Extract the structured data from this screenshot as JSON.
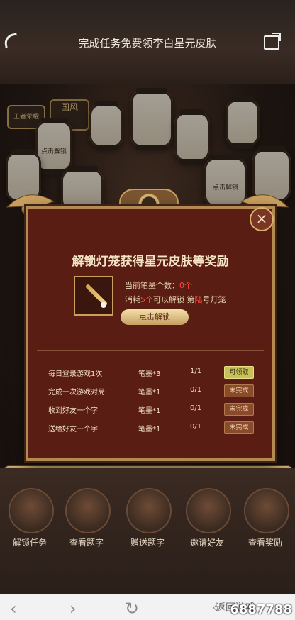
{
  "header": {
    "title": "完成任务免费领李白星元皮肤"
  },
  "scene": {
    "logo_text": "王者荣耀",
    "logo2_text": "国风",
    "lantern_label": "点击解锁"
  },
  "modal": {
    "title": "解锁灯笼获得星元皮肤等奖励",
    "current_label": "当前笔墨个数：",
    "current_value": "0个",
    "consume_prefix": "消耗",
    "consume_count": "5个",
    "consume_mid": "可以解锁 第",
    "consume_num": "陆",
    "consume_suffix": "号灯笼",
    "unlock_button": "点击解锁",
    "tasks": [
      {
        "name": "每日登录游戏1次",
        "reward": "笔墨*3",
        "progress": "1/1",
        "status": "可领取",
        "type": "claim"
      },
      {
        "name": "完成一次游戏对局",
        "reward": "笔墨*1",
        "progress": "0/1",
        "status": "未完成",
        "type": "undone"
      },
      {
        "name": "收到好友一个字",
        "reward": "笔墨*1",
        "progress": "0/1",
        "status": "未完成",
        "type": "undone"
      },
      {
        "name": "送给好友一个字",
        "reward": "笔墨*1",
        "progress": "0/1",
        "status": "未完成",
        "type": "undone"
      }
    ]
  },
  "footer": {
    "items": [
      {
        "label": "解锁任务"
      },
      {
        "label": "查看题字"
      },
      {
        "label": "赠送题字"
      },
      {
        "label": "邀请好友"
      },
      {
        "label": "查看奖励"
      }
    ]
  },
  "nav": {
    "back_text": "返回游戏",
    "watermark": "6887788"
  }
}
